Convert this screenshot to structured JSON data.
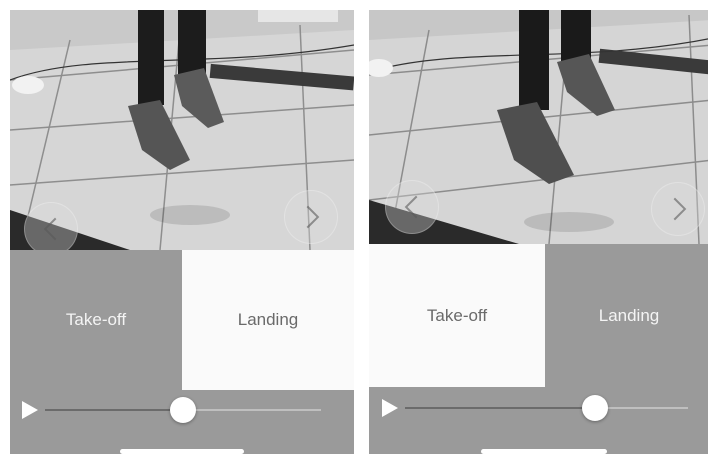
{
  "panels": [
    {
      "id": "left",
      "options": {
        "takeoff_label": "Take-off",
        "landing_label": "Landing",
        "selected": "landing"
      },
      "playback": {
        "progress": 0.5
      }
    },
    {
      "id": "right",
      "options": {
        "takeoff_label": "Take-off",
        "landing_label": "Landing",
        "selected": "takeoff"
      },
      "playback": {
        "progress": 0.67
      }
    }
  ],
  "icons": {
    "prev": "chevron-left-icon",
    "next": "chevron-right-icon",
    "play": "play-icon"
  },
  "colors": {
    "panel_bg": "#9a9a9a",
    "selected_bg": "#fafafa",
    "label_text": "#f4f4f4",
    "slider_fill": "#6b6b6b"
  }
}
